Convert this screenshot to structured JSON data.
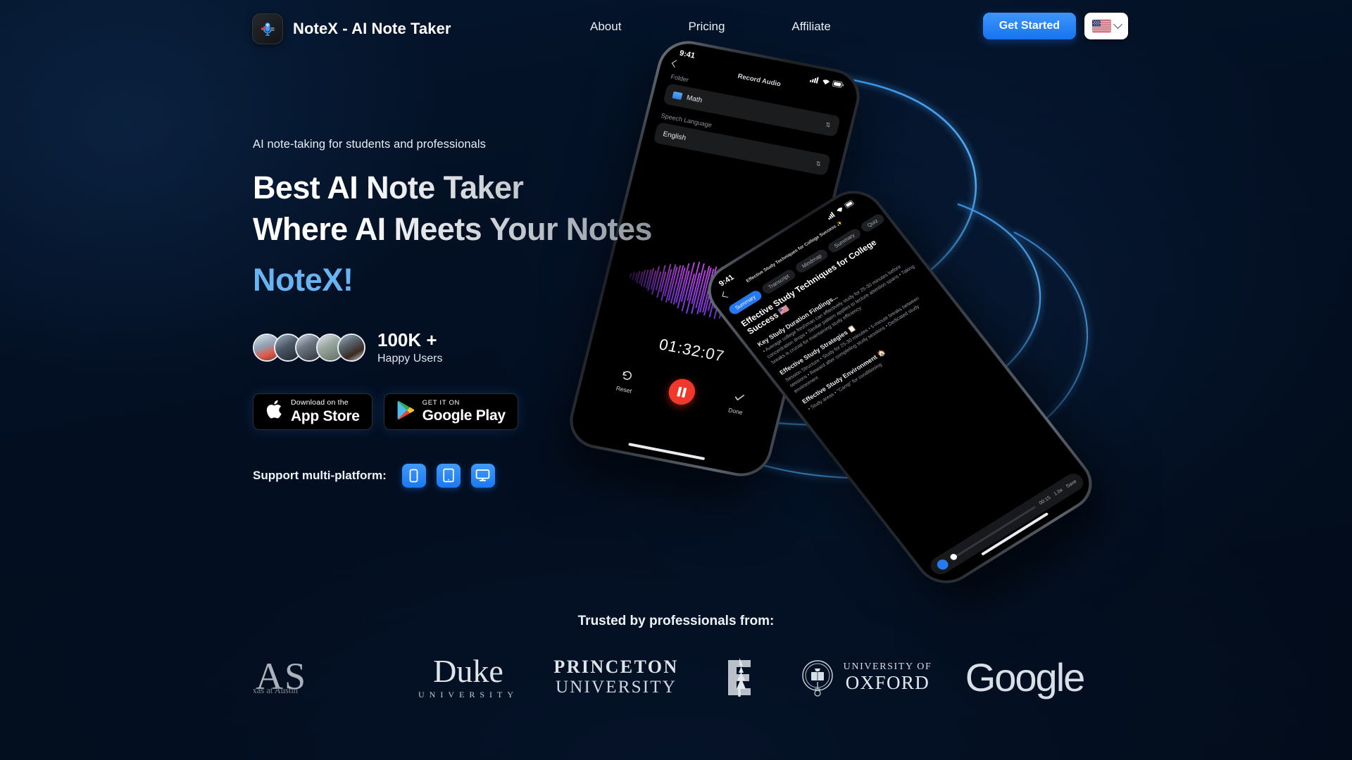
{
  "header": {
    "logo_icon": "microphone-icon",
    "brand_name": "NoteX - AI Note Taker",
    "nav": [
      {
        "label": "About"
      },
      {
        "label": "Pricing"
      },
      {
        "label": "Affiliate"
      }
    ],
    "cta_label": "Get Started",
    "language_icon": "us-flag-icon",
    "language_chevron": "chevron-down-icon"
  },
  "hero": {
    "eyebrow": "AI note-taking for students and professionals",
    "headline_line1": "Best AI Note Taker",
    "headline_line2": "Where AI Meets Your Notes",
    "headline_line3": "NoteX!",
    "accent_color": "#68b4f3",
    "users_count": "100K +",
    "users_label": "Happy Users",
    "avatars_count": 5,
    "stores": [
      {
        "icon": "apple-icon",
        "small": "Download on the",
        "large": "App Store"
      },
      {
        "icon": "google-play-icon",
        "small": "GET IT ON",
        "large": "Google Play"
      }
    ],
    "platform_label": "Support multi-platform:",
    "platforms": [
      {
        "icon": "phone-icon",
        "name": "mobile"
      },
      {
        "icon": "tablet-icon",
        "name": "tablet"
      },
      {
        "icon": "desktop-icon",
        "name": "desktop"
      }
    ]
  },
  "phone_record": {
    "status_time": "9:41",
    "title": "Record Audio",
    "folder_label": "Folder",
    "folder_value": "Math",
    "language_label": "Speech Language",
    "language_value": "English",
    "timer": "01:32:07",
    "reset_label": "Reset",
    "done_label": "Done",
    "waveform_color": "#c13df0"
  },
  "phone_note": {
    "status_time": "9:41",
    "header_title": "Effective Study Techniques for College Success ✨",
    "tabs": [
      {
        "label": "Summary",
        "active": true
      },
      {
        "label": "Transcript",
        "active": false
      },
      {
        "label": "Mindmap",
        "active": false
      },
      {
        "label": "Summary",
        "active": false
      },
      {
        "label": "Quiz",
        "active": false
      }
    ],
    "note_title": "Effective Study Techniques for College Success 🇺🇸",
    "sections": [
      {
        "heading": "Key Study Duration Findings...",
        "body": "• Average college freshman can effectively study for 25-30 minutes before concentration drops  • Similar pattern applies to lecture attention spans  • Taking breaks is crucial for maintaining study efficiency"
      },
      {
        "heading": "Effective Study Strategies 📋",
        "body": "Session Structure  • Study for 25-30 minutes  • 5-minute breaks between sessions  • Reward after completing study sessions  • Dedicated study environment"
      },
      {
        "heading": "Effective Study Environment 🏠",
        "body": "• Study areas  • \"Camp\" for conditioning"
      }
    ],
    "player_time": "00:15",
    "player_rate": "1.0x",
    "player_btn": "Save"
  },
  "trusted": {
    "title": "Trusted by professionals from:",
    "logos": [
      {
        "name": "texas-logo",
        "text": "XAS",
        "sub": "ty of Texas at Austin"
      },
      {
        "name": "duke-logo",
        "text": "Duke",
        "sub": "UNIVERSITY"
      },
      {
        "name": "princeton-logo",
        "text": "PRINCETON",
        "sub": "UNIVERSITY"
      },
      {
        "name": "stanford-logo",
        "text": "S",
        "sub": ""
      },
      {
        "name": "oxford-logo",
        "text": "UNIVERSITY OF",
        "sub": "OXFORD"
      },
      {
        "name": "google-logo",
        "text": "Google",
        "sub": ""
      }
    ]
  }
}
